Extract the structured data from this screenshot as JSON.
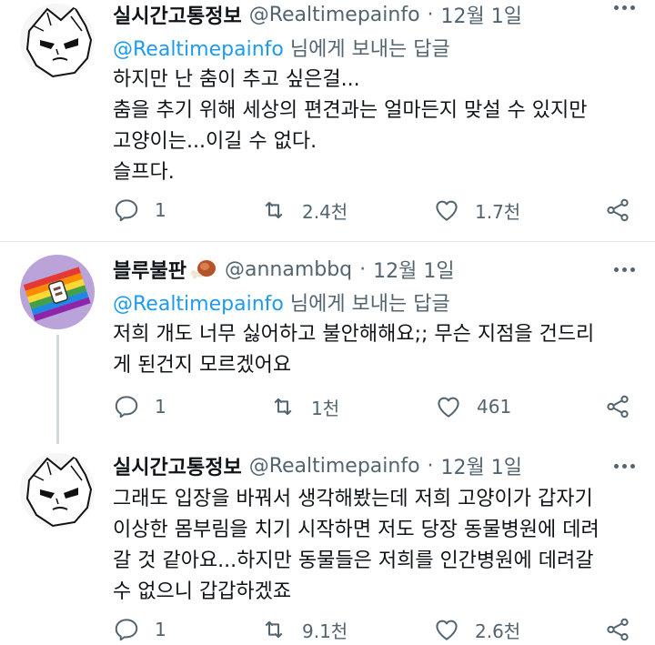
{
  "tweets": [
    {
      "name": "실시간고통정보",
      "handle": "@Realtimepainfo",
      "dot": "·",
      "date": "12월 1일",
      "reply_mention": "@Realtimepainfo",
      "reply_suffix": " 님에게 보내는 답글",
      "lines": [
        "하지만 난 춤이 추고 싶은걸...",
        "춤을 추기 위해 세상의 편견과는 얼마든지 맞설 수 있지만",
        "고양이는...이길 수 없다.",
        "슬프다."
      ],
      "replies": "1",
      "retweets": "2.4천",
      "likes": "1.7천"
    },
    {
      "name": "블루불판",
      "emoji_icon": "meat-on-bone-icon",
      "handle": "@annambbq",
      "dot": "·",
      "date": "12월 1일",
      "reply_mention": "@Realtimepainfo",
      "reply_suffix": " 님에게 보내는 답글",
      "lines": [
        "저희 개도 너무 싫어하고 불안해해요;; 무슨 지점을 건드리",
        "게 된건지 모르겠어요"
      ],
      "replies": "1",
      "retweets": "1천",
      "likes": "461"
    },
    {
      "name": "실시간고통정보",
      "handle": "@Realtimepainfo",
      "dot": "·",
      "date": "12월 1일",
      "lines": [
        "그래도 입장을 바꿔서 생각해봤는데 저희 고양이가 갑자기",
        "이상한 몸부림을 치기 시작하면 저도 당장 동물병원에 데려",
        "갈 것 같아요...하지만 동물들은 저희를 인간병원에 데려갈",
        "수 없으니 갑갑하겠죠"
      ],
      "replies": "1",
      "retweets": "9.1천",
      "likes": "2.6천"
    }
  ],
  "colors": {
    "text": "#0f1419",
    "secondary": "#536471",
    "link": "#1d9bf0",
    "divider": "#e1e8ed"
  }
}
